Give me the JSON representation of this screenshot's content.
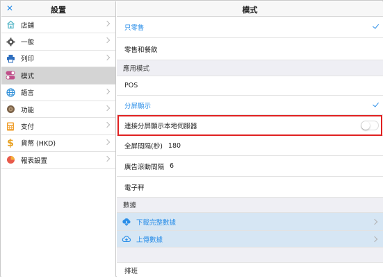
{
  "sidebar": {
    "close_icon": "close-icon",
    "title": "設置",
    "items": [
      {
        "label": "店鋪",
        "icon": "store-icon"
      },
      {
        "label": "一般",
        "icon": "gear-icon"
      },
      {
        "label": "列印",
        "icon": "printer-icon"
      },
      {
        "label": "模式",
        "icon": "toggle-icon",
        "selected": true
      },
      {
        "label": "語言",
        "icon": "globe-icon"
      },
      {
        "label": "功能",
        "icon": "function-icon"
      },
      {
        "label": "支付",
        "icon": "calculator-icon"
      },
      {
        "label": "貨幣 (HKD)",
        "icon": "dollar-icon"
      },
      {
        "label": "報表設置",
        "icon": "report-icon"
      }
    ]
  },
  "main": {
    "title": "模式",
    "mode_options": [
      {
        "label": "只零售",
        "selected": true
      },
      {
        "label": "零售和餐飲",
        "selected": false
      }
    ],
    "app_mode_section": "應用模式",
    "app_modes": [
      {
        "label": "POS",
        "selected": false
      },
      {
        "label": "分屏顯示",
        "selected": true
      }
    ],
    "connect_local_server": {
      "label": "連接分屏顯示本地伺服器",
      "enabled": false
    },
    "fullscreen_interval": {
      "label": "全屏間隔(秒)",
      "value": "180"
    },
    "ad_scroll_interval": {
      "label": "廣告滾動間隔",
      "value": "6"
    },
    "scale": {
      "label": "電子秤"
    },
    "data_section": "數據",
    "data_actions": [
      {
        "label": "下載完整數據",
        "icon": "cloud-download-icon"
      },
      {
        "label": "上傳數據",
        "icon": "cloud-upload-icon"
      }
    ],
    "schedule": {
      "label": "排班"
    }
  },
  "colors": {
    "accent": "#2a8ee8",
    "highlight_border": "#e02020",
    "selected_sidebar": "#d4d4d4",
    "data_row_bg": "#d6e6f4",
    "section_bg": "#efeff4"
  }
}
